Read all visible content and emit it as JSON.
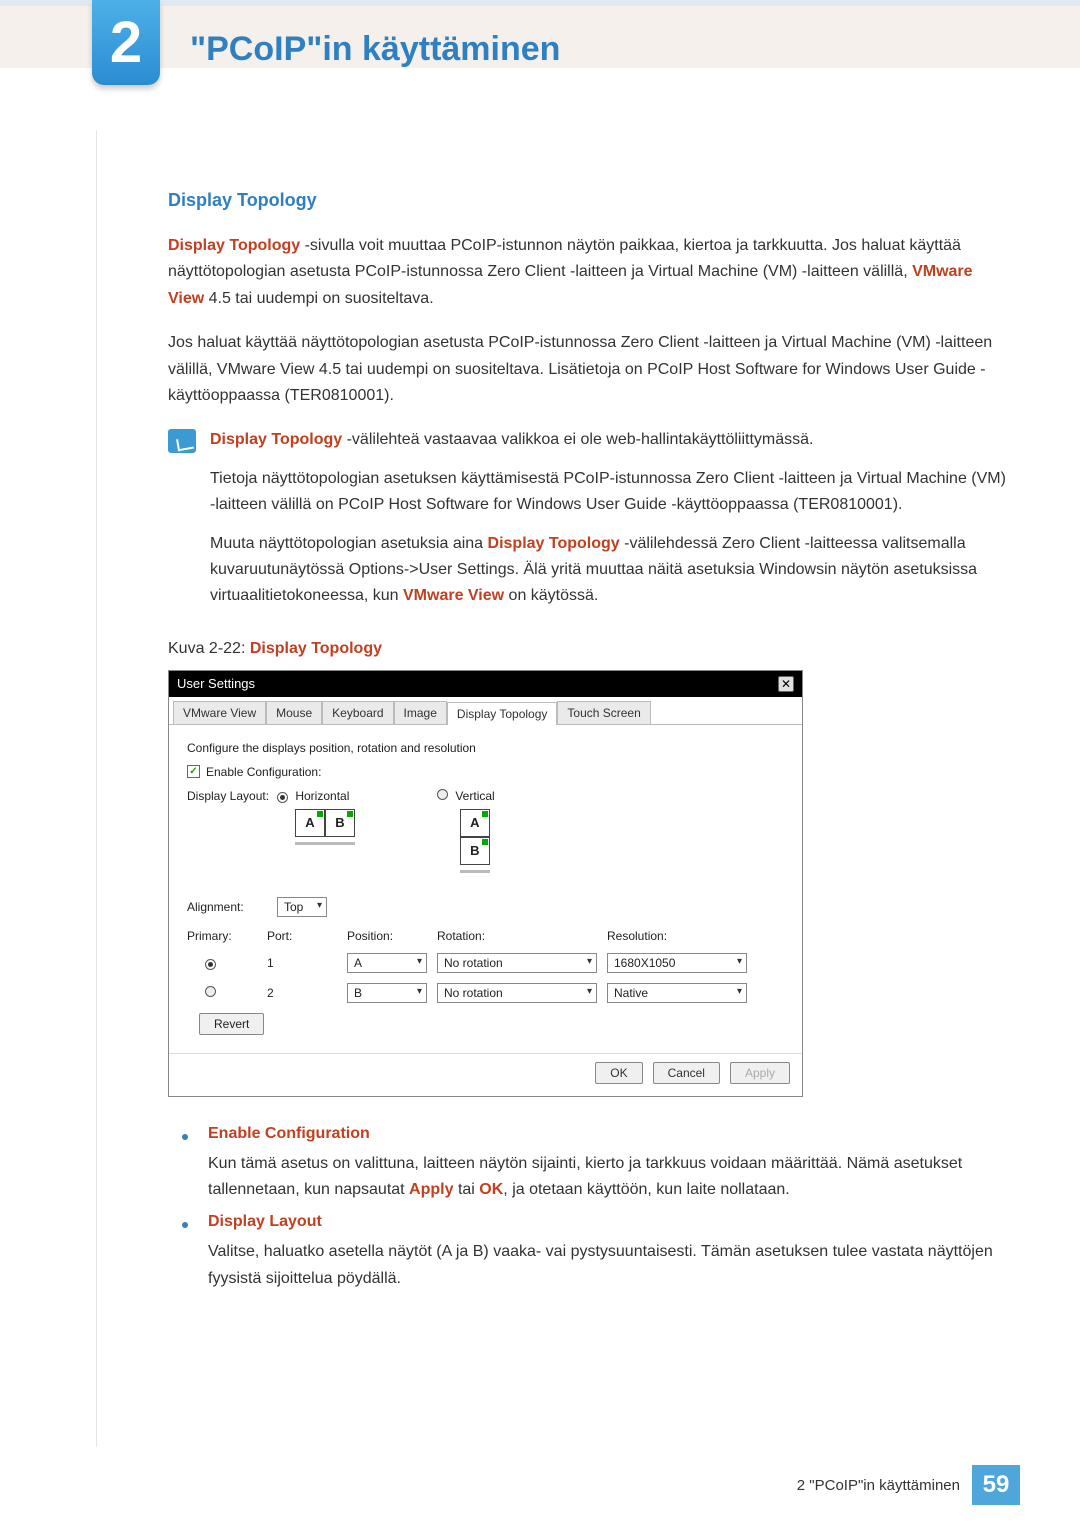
{
  "chapter": {
    "number": "2",
    "title": "\"PCoIP\"in käyttäminen"
  },
  "section": {
    "heading": "Display Topology"
  },
  "para1": {
    "lead": "Display Topology",
    "t1": " -sivulla voit muuttaa PCoIP-istunnon näytön paikkaa, kiertoa ja tarkkuutta. Jos haluat käyttää näyttötopologian asetusta PCoIP-istunnossa Zero Client -laitteen ja Virtual Machine (VM) -laitteen välillä, ",
    "lead2": "VMware View",
    "t2": " 4.5 tai uudempi on suositeltava."
  },
  "para2": "Jos haluat käyttää näyttötopologian asetusta PCoIP-istunnossa Zero Client -laitteen ja Virtual Machine (VM) -laitteen välillä, VMware View 4.5 tai uudempi on suositeltava. Lisätietoja on PCoIP Host Software for Windows User Guide -käyttöoppaassa (TER0810001).",
  "note": {
    "p1_lead": "Display Topology",
    "p1": " -välilehteä vastaavaa valikkoa ei ole web-hallintakäyttöliittymässä.",
    "p2": "Tietoja näyttötopologian asetuksen käyttämisestä PCoIP-istunnossa Zero Client -laitteen ja Virtual Machine (VM) -laitteen välillä on PCoIP Host Software for Windows User Guide -käyttöoppaassa (TER0810001).",
    "p3_a": "Muuta näyttötopologian asetuksia aina ",
    "p3_lead": "Display Topology",
    "p3_b": " -välilehdessä Zero Client -laitteessa valitsemalla kuvaruutunäytössä Options->User Settings. Älä yritä muuttaa näitä asetuksia Windowsin näytön asetuksissa virtuaalitietokoneessa, kun ",
    "p3_lead2": "VMware View",
    "p3_c": " on käytössä."
  },
  "figure": {
    "prefix": "Kuva 2-22: ",
    "name": "Display Topology"
  },
  "us": {
    "title": "User Settings",
    "tabs": [
      "VMware View",
      "Mouse",
      "Keyboard",
      "Image",
      "Display Topology",
      "Touch Screen"
    ],
    "active_tab_index": 4,
    "instruction": "Configure the displays position, rotation and resolution",
    "enable_label": "Enable Configuration:",
    "display_layout_label": "Display Layout:",
    "radio_h": "Horizontal",
    "radio_v": "Vertical",
    "ab_a": "A",
    "ab_b": "B",
    "alignment_label": "Alignment:",
    "alignment_value": "Top",
    "primary_label": "Primary:",
    "port_label": "Port:",
    "position_label": "Position:",
    "rotation_label": "Rotation:",
    "resolution_label": "Resolution:",
    "rows": [
      {
        "port": "1",
        "position": "A",
        "rotation": "No rotation",
        "resolution": "1680X1050",
        "primary": true
      },
      {
        "port": "2",
        "position": "B",
        "rotation": "No rotation",
        "resolution": "Native",
        "primary": false
      }
    ],
    "revert": "Revert",
    "ok": "OK",
    "cancel": "Cancel",
    "apply": "Apply"
  },
  "bullets": {
    "b1": {
      "title": "Enable Configuration",
      "text_a": "Kun tämä asetus on valittuna, laitteen näytön sijainti, kierto ja tarkkuus voidaan määrittää. Nämä asetukset tallennetaan, kun napsautat ",
      "apply": "Apply",
      "text_b": " tai ",
      "ok": "OK",
      "text_c": ", ja otetaan käyttöön, kun laite nollataan."
    },
    "b2": {
      "title": "Display Layout",
      "text": "Valitse, haluatko asetella näytöt (A ja B) vaaka- vai pystysuuntaisesti. Tämän asetuksen tulee vastata näyttöjen fyysistä sijoittelua pöydällä."
    }
  },
  "footer": {
    "label": "2 \"PCoIP\"in käyttäminen",
    "page": "59"
  }
}
